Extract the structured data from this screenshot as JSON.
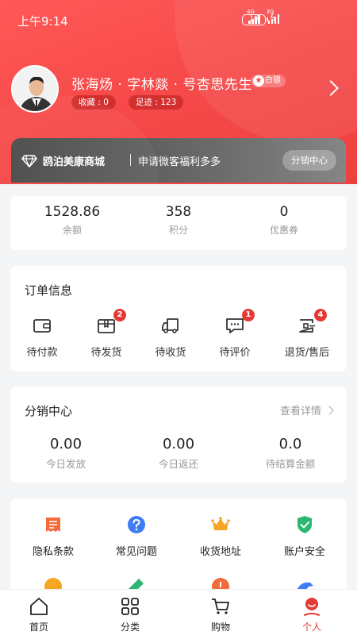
{
  "status_bar": {
    "time": "上午9:14",
    "net1": "4G",
    "net2": "3G",
    "battery": "16"
  },
  "profile": {
    "username": "张海炀 · 字林燚 · 号杏思先生",
    "vip_level": "白银",
    "favorites_label": "收藏 : 0",
    "footprints_label": "足迹 : 123"
  },
  "shop": {
    "name": "鸥泊美康商城",
    "slogan": "申请微客福利多多",
    "button_label": "分销中心"
  },
  "stats": [
    {
      "value": "1528.86",
      "label": "余额"
    },
    {
      "value": "358",
      "label": "积分"
    },
    {
      "value": "0",
      "label": "优惠券"
    }
  ],
  "orders": {
    "title": "订单信息",
    "items": [
      {
        "label": "待付款",
        "icon": "wallet-icon",
        "badge": ""
      },
      {
        "label": "待发货",
        "icon": "package-icon",
        "badge": "2"
      },
      {
        "label": "待收货",
        "icon": "truck-icon",
        "badge": ""
      },
      {
        "label": "待评价",
        "icon": "comment-icon",
        "badge": "1"
      },
      {
        "label": "退货/售后",
        "icon": "return-icon",
        "badge": "4"
      }
    ]
  },
  "distribution": {
    "title": "分销中心",
    "details_label": "查看详情",
    "stats": [
      {
        "value": "0.00",
        "label": "今日发放"
      },
      {
        "value": "0.00",
        "label": "今日返还"
      },
      {
        "value": "0.0",
        "label": "待结算金额"
      }
    ]
  },
  "services": [
    {
      "label": "隐私条款",
      "icon": "document-icon",
      "color": "#f26b3a"
    },
    {
      "label": "常见问题",
      "icon": "question-icon",
      "color": "#3d7cf5"
    },
    {
      "label": "收货地址",
      "icon": "crown-icon",
      "color": "#f5a623"
    },
    {
      "label": "账户安全",
      "icon": "shield-check-icon",
      "color": "#2bb673"
    }
  ],
  "services_row2_colors": [
    "#f5a623",
    "#2bb673",
    "#f26b3a",
    "#3d7cf5"
  ],
  "tabbar": [
    {
      "label": "首页",
      "icon": "home-icon",
      "active": false
    },
    {
      "label": "分类",
      "icon": "grid-icon",
      "active": false
    },
    {
      "label": "购物",
      "icon": "cart-icon",
      "active": false
    },
    {
      "label": "个人",
      "icon": "person-icon",
      "active": true
    }
  ],
  "colors": {
    "brand_red": "#f54848",
    "badge_red": "#e53935",
    "banner_dark": "#4b4b4b"
  }
}
